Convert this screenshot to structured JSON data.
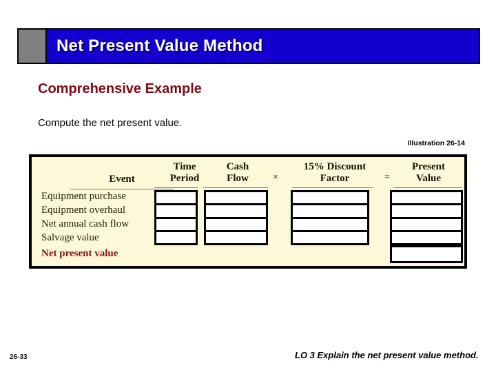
{
  "slide": {
    "title": "Net Present Value Method",
    "subtitle": "Comprehensive Example",
    "lead_text": "Compute the net present value.",
    "illustration_label": "Illustration 26-14"
  },
  "colors": {
    "title_bar": "#1300cf",
    "title_accent": "#808080",
    "subtitle_red": "#7d0b14",
    "table_background": "#fcf8d8",
    "total_label_red": "#8b1016"
  },
  "table": {
    "columns": [
      {
        "id": "event",
        "label": "Event"
      },
      {
        "id": "time_period",
        "label": "Time\nPeriod"
      },
      {
        "id": "cash_flow",
        "label": "Cash\nFlow"
      },
      {
        "id": "discount_factor",
        "label": "15% Discount\nFactor"
      },
      {
        "id": "present_value",
        "label": "Present\nValue"
      }
    ],
    "operators": [
      {
        "id": "multiply",
        "symbol": "×"
      },
      {
        "id": "equals",
        "symbol": "="
      }
    ],
    "rows": [
      {
        "label": "Equipment purchase",
        "time_period": "",
        "cash_flow": "",
        "discount_factor": "",
        "present_value": ""
      },
      {
        "label": "Equipment overhaul",
        "time_period": "",
        "cash_flow": "",
        "discount_factor": "",
        "present_value": ""
      },
      {
        "label": "Net annual cash flow",
        "time_period": "",
        "cash_flow": "",
        "discount_factor": "",
        "present_value": ""
      },
      {
        "label": "Salvage value",
        "time_period": "",
        "cash_flow": "",
        "discount_factor": "",
        "present_value": ""
      }
    ],
    "total_row": {
      "label": "Net present value",
      "present_value": ""
    }
  },
  "footer": {
    "page_number": "26-33",
    "learning_objective": "LO 3  Explain the net present value method."
  }
}
